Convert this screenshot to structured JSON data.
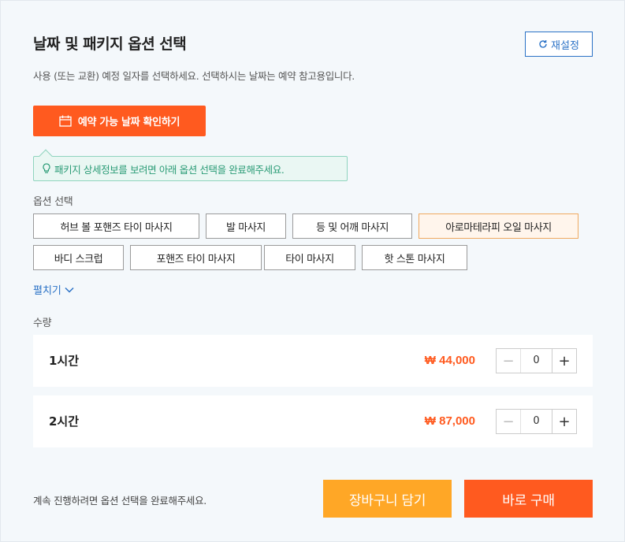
{
  "header": {
    "title": "날짜 및 패키지 옵션 선택",
    "reset_label": "재설정"
  },
  "date": {
    "description": "사용 (또는 교환) 예정 일자를 선택하세요. 선택하시는 날짜는 예약 참고용입니다.",
    "check_button_label": "예약 가능 날짜 확인하기"
  },
  "notice": {
    "text": "패키지 상세정보를 보려면 아래 옵션 선택을 완료해주세요."
  },
  "options": {
    "label": "옵션 선택",
    "items": [
      {
        "label": "허브 볼 포핸즈 타이 마사지"
      },
      {
        "label": "발 마사지"
      },
      {
        "label": "등 및 어깨 마사지"
      },
      {
        "label": "아로마테라피 오일 마사지",
        "selected": true
      },
      {
        "label": "바디 스크럽"
      },
      {
        "label": "포핸즈 타이 마사지"
      },
      {
        "label": "타이 마사지"
      },
      {
        "label": "핫 스톤 마사지"
      }
    ],
    "expand_label": "펼치기"
  },
  "quantity": {
    "label": "수량",
    "rows": [
      {
        "name": "1시간",
        "price": "₩ 44,000",
        "value": "0"
      },
      {
        "name": "2시간",
        "price": "₩ 87,000",
        "value": "0"
      }
    ]
  },
  "footer": {
    "note": "계속 진행하려면 옵션 선택을 완료해주세요.",
    "cart_label": "장바구니 담기",
    "buy_label": "바로 구매"
  },
  "colors": {
    "accent": "#ff5a1f",
    "cart": "#ffa726",
    "link": "#2b72c6",
    "notice": "#2a9b76"
  }
}
